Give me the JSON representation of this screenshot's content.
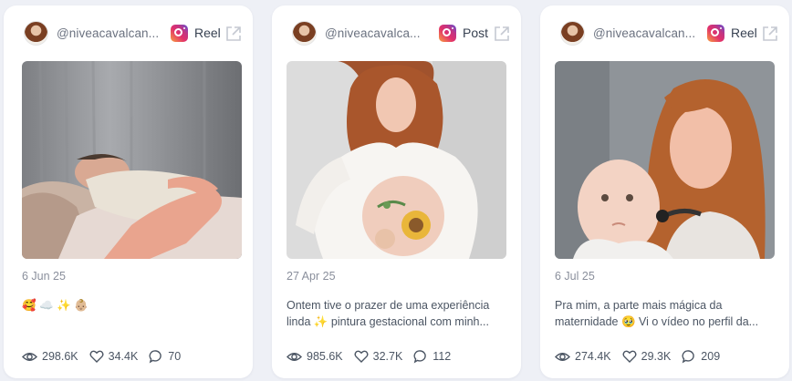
{
  "cards": [
    {
      "handle": "@niveacavalcan...",
      "platform_icon": "instagram-icon",
      "type": "Reel",
      "date": "6 Jun 25",
      "caption": [
        "🥰 ☁️ ✨ 👶🏼"
      ],
      "stats": {
        "views": "298.6K",
        "likes": "34.4K",
        "comments": "70"
      }
    },
    {
      "handle": "@niveacavalca...",
      "platform_icon": "instagram-icon",
      "type": "Post",
      "date": "27 Apr 25",
      "caption": [
        "Ontem tive o prazer de uma experiência",
        "linda ✨ pintura gestacional com minh..."
      ],
      "stats": {
        "views": "985.6K",
        "likes": "32.7K",
        "comments": "112"
      }
    },
    {
      "handle": "@niveacavalcan...",
      "platform_icon": "instagram-icon",
      "type": "Reel",
      "date": "6 Jul 25",
      "caption": [
        "Pra mim, a parte mais mágica da",
        "maternidade 🥹 Vi o vídeo no perfil da..."
      ],
      "stats": {
        "views": "274.4K",
        "likes": "29.3K",
        "comments": "209"
      }
    }
  ]
}
